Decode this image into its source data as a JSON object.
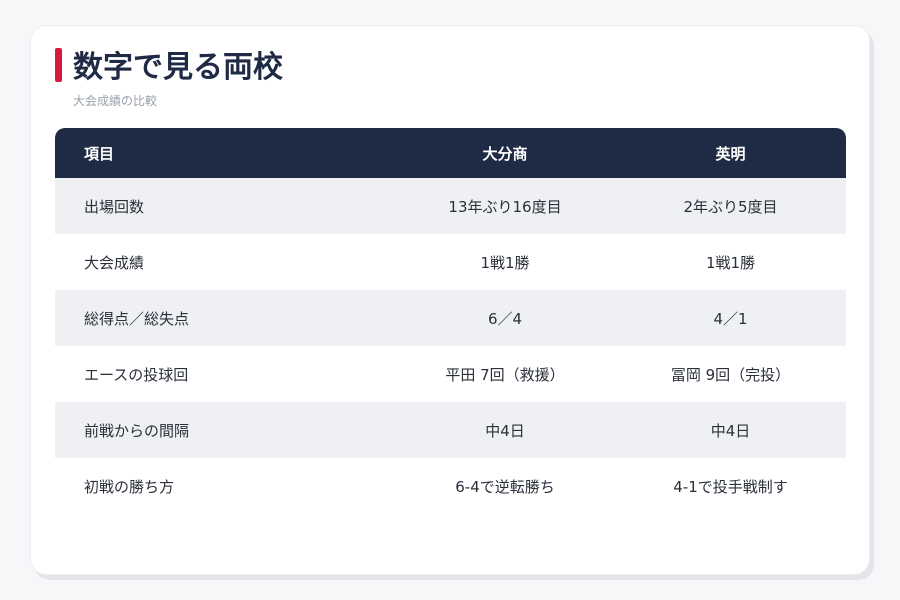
{
  "title": "数字で見る両校",
  "subtitle": "大会成績の比較",
  "colors": {
    "accent": "#d7193f",
    "header_bg": "#1f2a44",
    "alt_row_bg": "#eff0f3"
  },
  "table": {
    "headers": [
      "項目",
      "大分商",
      "英明"
    ],
    "rows": [
      [
        "出場回数",
        "13年ぶり16度目",
        "2年ぶり5度目"
      ],
      [
        "大会成績",
        "1戦1勝",
        "1戦1勝"
      ],
      [
        "総得点／総失点",
        "6／4",
        "4／1"
      ],
      [
        "エースの投球回",
        "平田 7回（救援）",
        "冨岡 9回（完投）"
      ],
      [
        "前戦からの間隔",
        "中4日",
        "中4日"
      ],
      [
        "初戦の勝ち方",
        "6-4で逆転勝ち",
        "4-1で投手戦制す"
      ]
    ]
  }
}
